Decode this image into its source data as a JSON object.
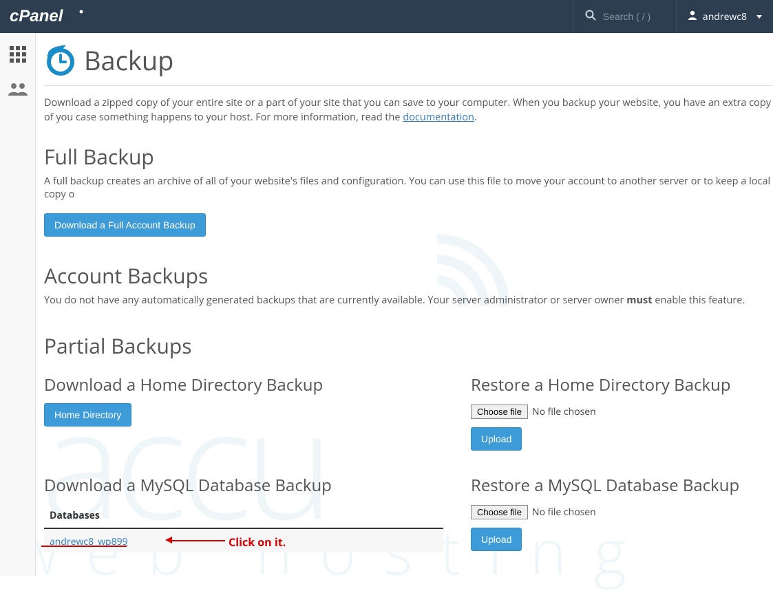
{
  "header": {
    "logo_text": "cPanel",
    "search_placeholder": "Search ( / )",
    "username": "andrewc8"
  },
  "page": {
    "title": "Backup",
    "intro_text_before_link": "Download a zipped copy of your entire site or a part of your site that you can save to your computer. When you backup your website, you have an extra copy of you case something happens to your host. For more information, read the ",
    "intro_link": "documentation",
    "intro_text_after_link": "."
  },
  "full_backup": {
    "heading": "Full Backup",
    "desc": "A full backup creates an archive of all of your website's files and configuration. You can use this file to move your account to another server or to keep a local copy o",
    "button": "Download a Full Account Backup"
  },
  "account_backups": {
    "heading": "Account Backups",
    "desc_before": "You do not have any automatically generated backups that are currently available. Your server administrator or server owner ",
    "desc_bold": "must",
    "desc_after": " enable this feature."
  },
  "partial": {
    "heading": "Partial Backups",
    "home_download_heading": "Download a Home Directory Backup",
    "home_download_button": "Home Directory",
    "home_restore_heading": "Restore a Home Directory Backup",
    "choose_file": "Choose file",
    "no_file": "No file chosen",
    "upload": "Upload",
    "mysql_download_heading": "Download a MySQL Database Backup",
    "mysql_restore_heading": "Restore a MySQL Database Backup",
    "db_col_header": "Databases",
    "db_name": "andrewc8_wp899"
  },
  "annotation": {
    "text": "Click on it."
  }
}
